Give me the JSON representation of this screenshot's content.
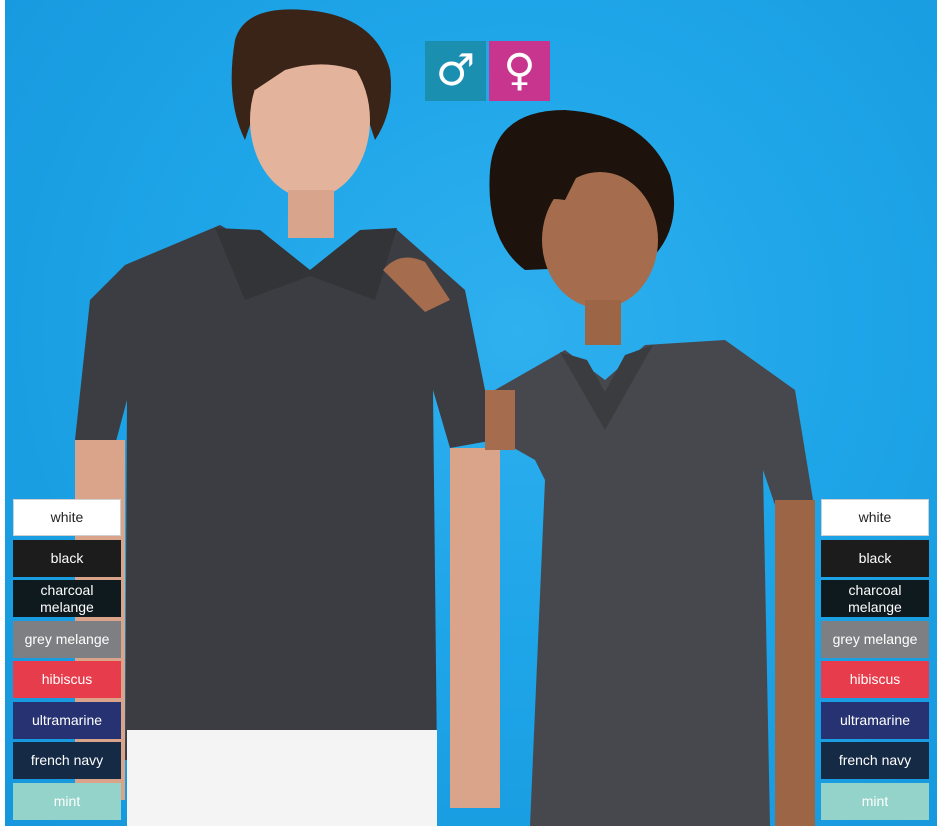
{
  "gender_icons": [
    {
      "symbol": "♂",
      "icon": "male-symbol-icon",
      "color": "#1a8fb0"
    },
    {
      "symbol": "♀",
      "icon": "female-symbol-icon",
      "color": "#c8358e"
    }
  ],
  "colors": [
    {
      "label": "white",
      "bg": "#ffffff",
      "fg": "#222222"
    },
    {
      "label": "black",
      "bg": "#1c1c1c",
      "fg": "#ffffff"
    },
    {
      "label": "charcoal melange",
      "bg": "#0f1a1f",
      "fg": "#ffffff"
    },
    {
      "label": "grey melange",
      "bg": "#7e7f82",
      "fg": "#ffffff"
    },
    {
      "label": "hibiscus",
      "bg": "#e63c4b",
      "fg": "#ffffff"
    },
    {
      "label": "ultramarine",
      "bg": "#263271",
      "fg": "#ffffff"
    },
    {
      "label": "french navy",
      "bg": "#152a45",
      "fg": "#ffffff"
    },
    {
      "label": "mint",
      "bg": "#93d3c9",
      "fg": "#ffffff"
    }
  ]
}
